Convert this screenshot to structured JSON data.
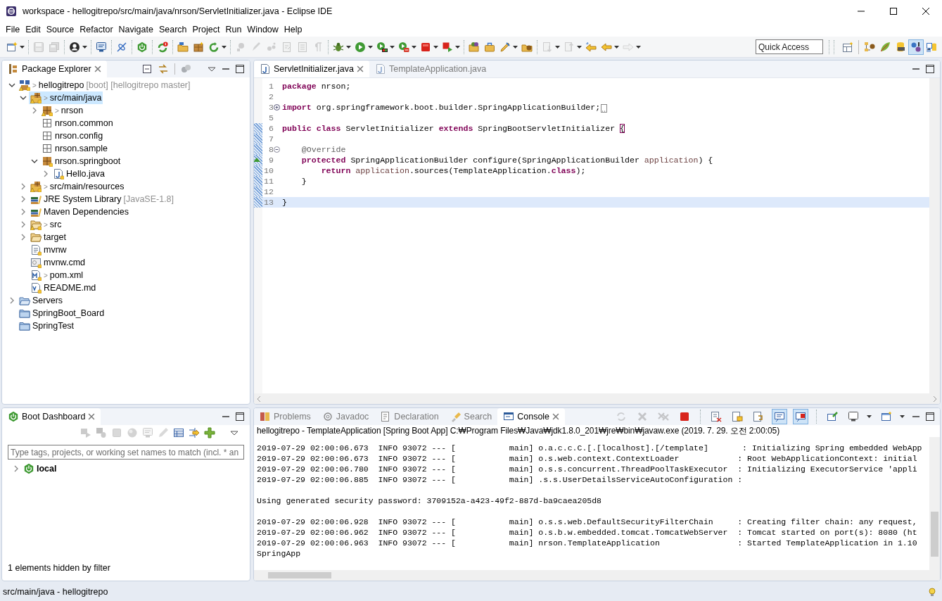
{
  "window": {
    "title": "workspace - hellogitrepo/src/main/java/nrson/ServletInitializer.java - Eclipse IDE"
  },
  "menu": [
    "File",
    "Edit",
    "Source",
    "Refactor",
    "Navigate",
    "Search",
    "Project",
    "Run",
    "Window",
    "Help"
  ],
  "toolbar": {
    "groups": [
      [
        {
          "dropdown": true,
          "disabled": false
        }
      ],
      [
        {
          "dropdown": false,
          "disabled": true
        },
        {
          "dropdown": false,
          "disabled": true
        }
      ],
      [
        {
          "dropdown": true,
          "disabled": false
        }
      ],
      [
        {
          "dropdown": false,
          "disabled": false
        }
      ],
      [
        {
          "dropdown": false,
          "disabled": false
        }
      ],
      [
        {
          "dropdown": false,
          "disabled": false
        }
      ],
      [
        {
          "dropdown": false,
          "disabled": false
        }
      ],
      [
        {
          "dropdown": false,
          "disabled": false
        },
        {
          "dropdown": false,
          "disabled": false
        },
        {
          "dropdown": true,
          "disabled": false
        }
      ],
      [
        {
          "dropdown": false,
          "disabled": true
        },
        {
          "dropdown": false,
          "disabled": true
        },
        {
          "dropdown": false,
          "disabled": true
        },
        {
          "dropdown": false,
          "disabled": true
        },
        {
          "dropdown": false,
          "disabled": true
        },
        {
          "dropdown": false,
          "disabled": true
        }
      ],
      [
        {
          "dropdown": true,
          "disabled": false
        },
        {
          "dropdown": true,
          "disabled": false
        },
        {
          "dropdown": true,
          "disabled": false
        },
        {
          "dropdown": true,
          "disabled": false
        },
        {
          "dropdown": true,
          "disabled": false
        },
        {
          "dropdown": true,
          "disabled": false
        }
      ],
      [
        {
          "dropdown": false,
          "disabled": false
        },
        {
          "dropdown": false,
          "disabled": false
        },
        {
          "dropdown": true,
          "disabled": false
        },
        {
          "dropdown": false,
          "disabled": false
        }
      ],
      [
        {
          "dropdown": true,
          "disabled": true
        },
        {
          "dropdown": true,
          "disabled": true
        },
        {
          "dropdown": false,
          "disabled": false
        },
        {
          "dropdown": true,
          "disabled": false
        },
        {
          "dropdown": true,
          "disabled": true
        }
      ]
    ],
    "quick_access": {
      "placeholder": "Quick Access"
    },
    "perspectives": [
      {
        "selected": false
      },
      {
        "selected": false
      },
      {
        "selected": false
      },
      {
        "selected": false
      },
      {
        "selected": true
      },
      {
        "selected": false
      }
    ]
  },
  "package_explorer": {
    "title": "Package Explorer",
    "tree": [
      {
        "kind": "project",
        "prefix": ">",
        "label": "hellogitrepo",
        "suffix": "[boot] [hellogitrepo master]",
        "expanded": true,
        "selected": false,
        "tracked": true,
        "warning": true,
        "children": [
          {
            "kind": "source-folder",
            "prefix": ">",
            "label": "src/main/java",
            "expanded": true,
            "selected": true,
            "tracked": true,
            "warning": true,
            "children": [
              {
                "kind": "package",
                "prefix": ">",
                "label": "nrson",
                "expanded": false,
                "selected": false,
                "tracked": true,
                "warning": true
              },
              {
                "kind": "empty-package",
                "label": "nrson.common",
                "selected": false,
                "tracked": false,
                "warning": false
              },
              {
                "kind": "empty-package",
                "label": "nrson.config",
                "selected": false,
                "tracked": false,
                "warning": false
              },
              {
                "kind": "empty-package",
                "label": "nrson.sample",
                "selected": false,
                "tracked": false,
                "warning": false
              },
              {
                "kind": "package",
                "label": "nrson.springboot",
                "expanded": true,
                "selected": false,
                "tracked": true,
                "warning": false,
                "children": [
                  {
                    "kind": "java-file",
                    "label": "Hello.java",
                    "expanded": false,
                    "selected": false,
                    "tracked": true,
                    "warning": false
                  }
                ]
              }
            ]
          },
          {
            "kind": "source-folder",
            "prefix": ">",
            "label": "src/main/resources",
            "expanded": false,
            "selected": false,
            "tracked": true,
            "warning": true
          },
          {
            "kind": "library",
            "label": "JRE System Library",
            "suffix": "[JavaSE-1.8]",
            "expanded": false,
            "selected": false,
            "tracked": false,
            "warning": false
          },
          {
            "kind": "library",
            "label": "Maven Dependencies",
            "expanded": false,
            "selected": false,
            "tracked": false,
            "warning": false
          },
          {
            "kind": "folder",
            "prefix": ">",
            "label": "src",
            "expanded": false,
            "selected": false,
            "tracked": true,
            "warning": true
          },
          {
            "kind": "folder",
            "label": "target",
            "expanded": false,
            "selected": false,
            "tracked": false,
            "warning": false
          },
          {
            "kind": "text-file",
            "label": "mvnw",
            "selected": false,
            "tracked": true,
            "warning": false
          },
          {
            "kind": "cmd-file",
            "label": "mvnw.cmd",
            "selected": false,
            "tracked": true,
            "warning": false
          },
          {
            "kind": "xml-file",
            "prefix": ">",
            "label": "pom.xml",
            "selected": false,
            "tracked": true,
            "warning": false
          },
          {
            "kind": "md-file",
            "label": "README.md",
            "selected": false,
            "tracked": true,
            "warning": false
          }
        ]
      },
      {
        "kind": "server-folder",
        "label": "Servers",
        "expanded": false,
        "selected": false,
        "tracked": false,
        "warning": false
      },
      {
        "kind": "closed-project",
        "label": "SpringBoot_Board",
        "selected": false,
        "tracked": false,
        "warning": false
      },
      {
        "kind": "closed-project",
        "label": "SpringTest",
        "selected": false,
        "tracked": false,
        "warning": false
      }
    ]
  },
  "editor": {
    "tabs": [
      {
        "label": "ServletInitializer.java",
        "selected": true
      },
      {
        "label": "TemplateApplication.java",
        "selected": false
      }
    ],
    "lines": [
      {
        "number": "1",
        "kind": "plain",
        "changed": false,
        "current": false,
        "tokens": [
          {
            "kind": "keyword",
            "text": "package"
          },
          {
            "kind": "plain",
            "text": " nrson;"
          }
        ]
      },
      {
        "number": "2",
        "kind": "plain",
        "changed": false,
        "current": false
      },
      {
        "number": "3",
        "kind": "folded",
        "changed": false,
        "current": false,
        "tokens": [
          {
            "kind": "keyword",
            "text": "import"
          },
          {
            "kind": "plain",
            "text": " org.springframework.boot.builder.SpringApplicationBuilder;"
          }
        ]
      },
      {
        "number": "5",
        "kind": "plain",
        "changed": false,
        "current": false
      },
      {
        "number": "6",
        "kind": "plain",
        "changed": true,
        "current": false,
        "tokens": [
          {
            "kind": "keyword",
            "text": "public"
          },
          {
            "kind": "keyword",
            "text": " class"
          },
          {
            "kind": "plain",
            "text": " ServletInitializer "
          },
          {
            "kind": "keyword",
            "text": "extends"
          },
          {
            "kind": "plain",
            "text": " SpringBootServletInitializer "
          },
          {
            "kind": "bracket",
            "text": "{"
          }
        ]
      },
      {
        "number": "7",
        "kind": "plain",
        "changed": true,
        "current": false
      },
      {
        "number": "8",
        "kind": "foldable",
        "changed": true,
        "current": false,
        "tokens": [
          {
            "kind": "annotation",
            "text": "    @Override"
          }
        ]
      },
      {
        "number": "9",
        "kind": "override",
        "changed": true,
        "current": false,
        "tokens": [
          {
            "kind": "keyword",
            "text": "    protected"
          },
          {
            "kind": "plain",
            "text": " SpringApplicationBuilder configure(SpringApplicationBuilder "
          },
          {
            "kind": "variable",
            "text": "application"
          },
          {
            "kind": "plain",
            "text": ") {"
          }
        ]
      },
      {
        "number": "10",
        "kind": "plain",
        "changed": true,
        "current": false,
        "tokens": [
          {
            "kind": "keyword",
            "text": "        return"
          },
          {
            "kind": "variable",
            "text": " application"
          },
          {
            "kind": "plain",
            "text": ".sources(TemplateApplication."
          },
          {
            "kind": "keyword",
            "text": "class"
          },
          {
            "kind": "plain",
            "text": ");"
          }
        ]
      },
      {
        "number": "11",
        "kind": "plain",
        "changed": true,
        "current": false,
        "tokens": [
          {
            "kind": "plain",
            "text": "    }"
          }
        ]
      },
      {
        "number": "12",
        "kind": "plain",
        "changed": true,
        "current": false
      },
      {
        "number": "13",
        "kind": "plain",
        "changed": true,
        "current": true,
        "tokens": [
          {
            "kind": "plain",
            "text": "}"
          }
        ]
      }
    ]
  },
  "boot_dashboard": {
    "title": "Boot Dashboard",
    "toolbar": {
      "groups": [
        [
          {
            "dropdown": false,
            "disabled": true
          },
          {
            "dropdown": false,
            "disabled": true
          },
          {
            "dropdown": false,
            "disabled": true
          },
          {
            "dropdown": false,
            "disabled": true
          },
          {
            "dropdown": false,
            "disabled": true
          },
          {
            "dropdown": false,
            "disabled": true
          },
          {
            "dropdown": false,
            "disabled": false
          },
          {
            "dropdown": false,
            "disabled": false
          },
          {
            "dropdown": false,
            "disabled": false
          }
        ]
      ]
    },
    "filter": {
      "placeholder": "Type tags, projects, or working set names to match (incl. * an"
    },
    "tree": [
      {
        "label": "local",
        "expanded": false
      }
    ],
    "footer": "1 elements hidden by filter"
  },
  "console": {
    "tabs": [
      {
        "label": "Problems",
        "selected": false
      },
      {
        "label": "Javadoc",
        "selected": false
      },
      {
        "label": "Declaration",
        "selected": false
      },
      {
        "label": "Search",
        "selected": false
      },
      {
        "label": "Console",
        "selected": true
      }
    ],
    "toolbar": {
      "groups": [
        [
          {
            "dropdown": false,
            "disabled": true,
            "selected": false
          },
          {
            "dropdown": false,
            "disabled": true,
            "selected": false
          },
          {
            "dropdown": false,
            "disabled": true,
            "selected": false
          },
          {
            "dropdown": false,
            "disabled": false,
            "selected": false
          }
        ],
        [
          {
            "dropdown": false,
            "disabled": false,
            "selected": false
          },
          {
            "dropdown": false,
            "disabled": false,
            "selected": false
          },
          {
            "dropdown": false,
            "disabled": false,
            "selected": false
          },
          {
            "dropdown": false,
            "disabled": false,
            "selected": true
          },
          {
            "dropdown": false,
            "disabled": false,
            "selected": true
          }
        ],
        [
          {
            "dropdown": false,
            "disabled": false,
            "selected": false
          },
          {
            "dropdown": true,
            "disabled": false,
            "selected": false
          },
          {
            "dropdown": true,
            "disabled": false,
            "selected": false
          }
        ]
      ]
    },
    "header": "hellogitrepo - TemplateApplication [Spring Boot App] C:₩Program Files₩Java₩jdk1.8.0_201₩jre₩bin₩javaw.exe (2019. 7. 29. 오전 2:00:05)",
    "lines": [
      {
        "kind": "text",
        "text": "2019-07-29 02:00:06.673  INFO 93072 --- [           main] o.a.c.c.C.[.[localhost].[/template]       : Initializing Spring embedded WebApp"
      },
      {
        "kind": "text",
        "text": "2019-07-29 02:00:06.673  INFO 93072 --- [           main] o.s.web.context.ContextLoader            : Root WebApplicationContext: initial"
      },
      {
        "kind": "text",
        "text": "2019-07-29 02:00:06.780  INFO 93072 --- [           main] o.s.s.concurrent.ThreadPoolTaskExecutor  : Initializing ExecutorService 'appli"
      },
      {
        "kind": "text",
        "text": "2019-07-29 02:00:06.885  INFO 93072 --- [           main] .s.s.UserDetailsServiceAutoConfiguration :"
      },
      {
        "kind": "blank"
      },
      {
        "kind": "text",
        "text": "Using generated security password: 3709152a-a423-49f2-887d-ba9caea205d8"
      },
      {
        "kind": "blank"
      },
      {
        "kind": "text",
        "text": "2019-07-29 02:00:06.928  INFO 93072 --- [           main] o.s.s.web.DefaultSecurityFilterChain     : Creating filter chain: any request,"
      },
      {
        "kind": "text",
        "text": "2019-07-29 02:00:06.962  INFO 93072 --- [           main] o.s.b.w.embedded.tomcat.TomcatWebServer  : Tomcat started on port(s): 8080 (ht"
      },
      {
        "kind": "text",
        "text": "2019-07-29 02:00:06.963  INFO 93072 --- [           main] nrson.TemplateApplication                : Started TemplateApplication in 1.10"
      },
      {
        "kind": "text",
        "text": "SpringApp"
      }
    ]
  },
  "status_bar": {
    "text": "src/main/java - hellogitrepo"
  }
}
